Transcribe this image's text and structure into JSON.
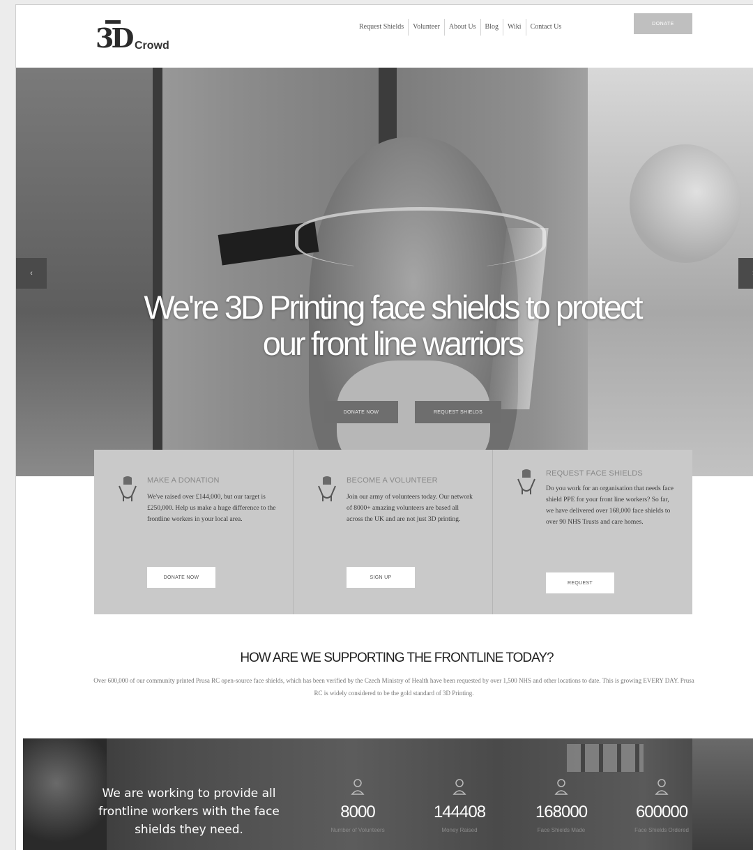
{
  "header": {
    "logo_text": "3D",
    "logo_subtext": "Crowd",
    "nav": [
      "Request Shields",
      "Volunteer",
      "About Us",
      "Blog",
      "Wiki",
      "Contact Us"
    ],
    "donate_label": "DONATE"
  },
  "hero": {
    "title_line1": "We're 3D Printing face shields to protect",
    "title_line2": "our front line warriors",
    "donate_button": "DONATE NOW",
    "request_button": "REQUEST SHIELDS",
    "prev_arrow": "‹",
    "next_arrow": "›"
  },
  "cards": [
    {
      "title": "MAKE A DONATION",
      "text": "We've raised over £144,000, but our target is £250,000. Help us make a huge difference to the frontline workers in your local area.",
      "button": "DONATE NOW",
      "icon": "hand-heart-icon"
    },
    {
      "title": "BECOME A VOLUNTEER",
      "text": "Join our army of volunteers today. Our network of 8000+ amazing volunteers are based all across the UK and are not just 3D printing.",
      "button": "SIGN UP",
      "icon": "hand-heart-icon"
    },
    {
      "title": "REQUEST FACE SHIELDS",
      "text": "Do you work for an organisation that needs face shield PPE for your front line workers? So far, we have delivered over 168,000 face shields to over 90 NHS Trusts and care homes.",
      "button": "REQUEST",
      "icon": "hand-heart-icon"
    }
  ],
  "support": {
    "title": "HOW ARE WE SUPPORTING THE FRONTLINE TODAY?",
    "text": "Over 600,000 of our community printed Prusa RC open-source face shields, which has been verified by the Czech Ministry of Health have been requested by over 1,500 NHS and other locations to date. This is growing EVERY DAY. Prusa RC is widely considered to be the gold standard of 3D Printing."
  },
  "stats": {
    "tagline": "We are working to provide all frontline workers with the face shields they need.",
    "items": [
      {
        "value": "8000",
        "label": "Number of Volunteers",
        "icon": "person-icon"
      },
      {
        "value": "144408",
        "label": "Money Raised",
        "icon": "person-icon"
      },
      {
        "value": "168000",
        "label": "Face Shields Made",
        "icon": "person-icon"
      },
      {
        "value": "600000",
        "label": "Face Shields Ordered",
        "icon": "person-icon"
      }
    ]
  }
}
